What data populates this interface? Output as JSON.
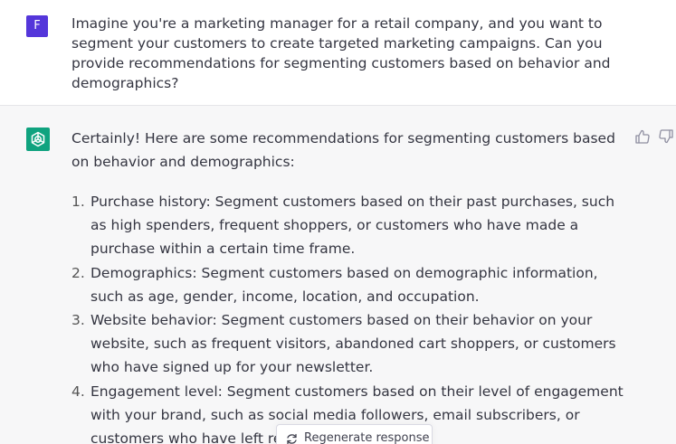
{
  "user": {
    "avatar_letter": "F",
    "avatar_color": "#5436da",
    "message": "Imagine you're a marketing manager for a retail company, and you want to segment your customers to create targeted marketing campaigns. Can you provide recommendations for segmenting customers based on behavior and demographics?"
  },
  "assistant": {
    "avatar_color": "#10a37f",
    "avatar_icon": "openai-logo-icon",
    "intro": "Certainly! Here are some recommendations for segmenting customers based on behavior and demographics:",
    "items": [
      {
        "num": "1.",
        "text": "Purchase history: Segment customers based on their past purchases, such as high spenders, frequent shoppers, or customers who have made a purchase within a certain time frame."
      },
      {
        "num": "2.",
        "text": "Demographics: Segment customers based on demographic information, such as age, gender, income, location, and occupation."
      },
      {
        "num": "3.",
        "text": "Website behavior: Segment customers based on their behavior on your website, such as frequent visitors, abandoned cart shoppers, or customers who have signed up for your newsletter."
      },
      {
        "num": "4.",
        "text": "Engagement level: Segment customers based on their level of engagement with your brand, such as social media followers, email subscribers, or customers who have left reviews."
      }
    ],
    "feedback_icons": [
      "thumbs-up-icon",
      "thumbs-down-icon"
    ]
  },
  "regenerate": {
    "label": "Regenerate response",
    "icon": "refresh-icon"
  }
}
